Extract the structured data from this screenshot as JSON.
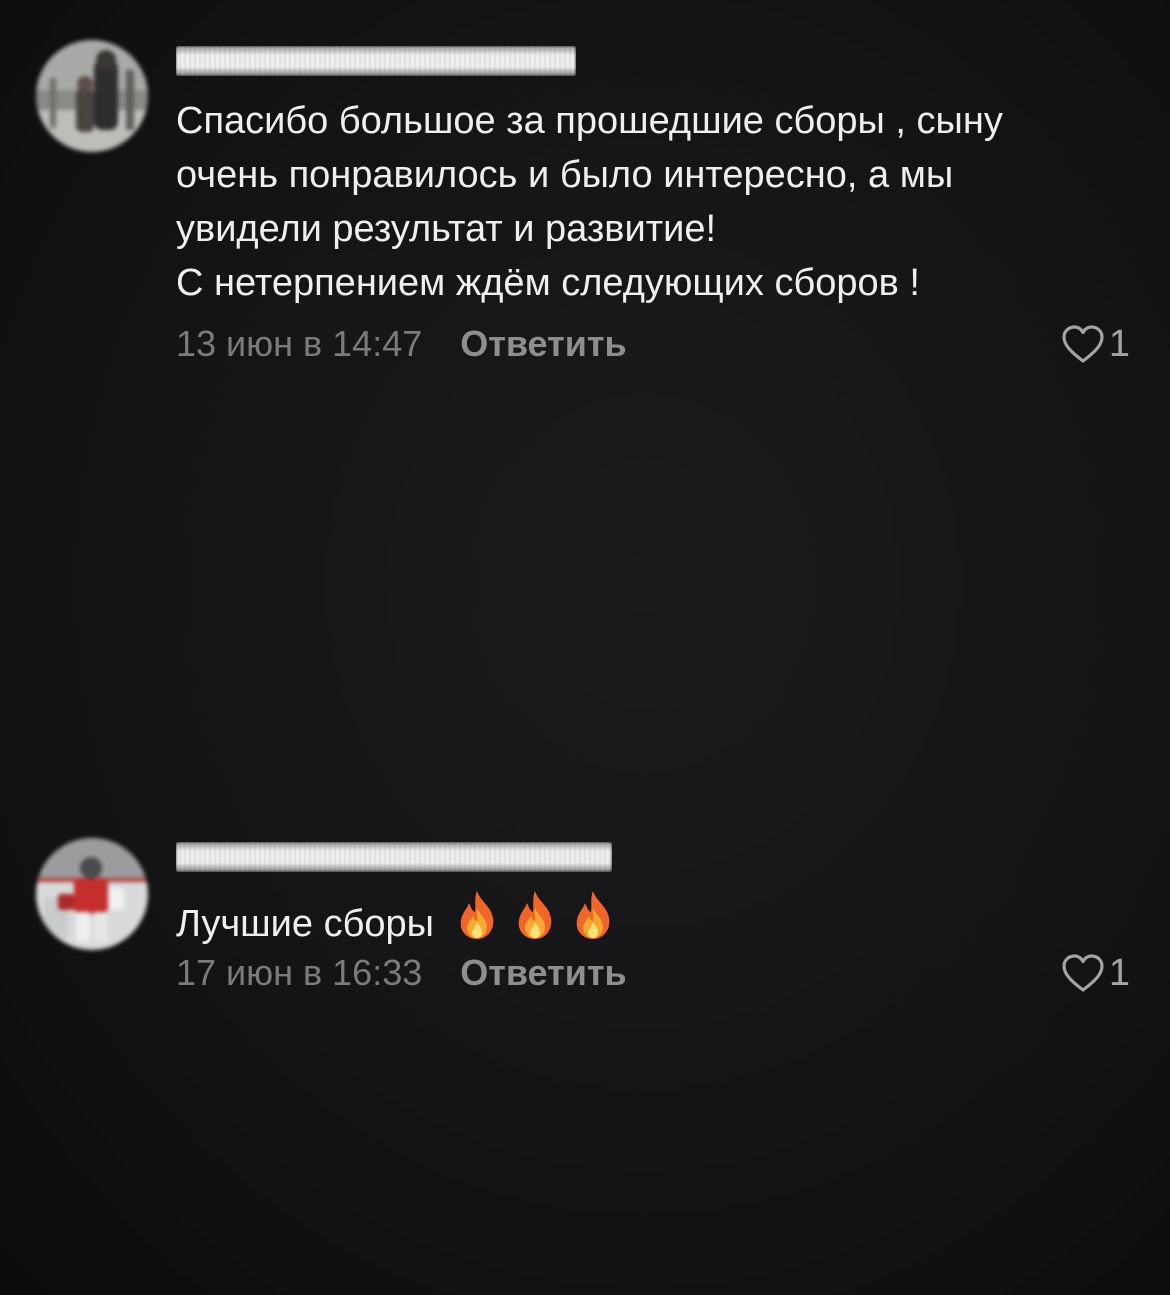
{
  "comments": [
    {
      "author_name": "",
      "lines": [
        "Спасибо большое за прошедшие сборы , сыну",
        "очень понравилось и было интересно, а мы",
        "увидели результат и развитие!",
        "С нетерпением ждём следующих сборов !"
      ],
      "timestamp": "13 июн в 14:47",
      "reply_label": "Ответить",
      "like_count": "1"
    },
    {
      "author_name": "",
      "text": "Лучшие сборы",
      "emojis": [
        "fire-icon",
        "fire-icon",
        "fire-icon"
      ],
      "timestamp": "17 июн в 16:33",
      "reply_label": "Ответить",
      "like_count": "1"
    }
  ],
  "colors": {
    "background": "#141416",
    "text": "#efefef",
    "meta": "#7b7b7e",
    "reply": "#8e8e91",
    "like": "#a4a4a7"
  }
}
